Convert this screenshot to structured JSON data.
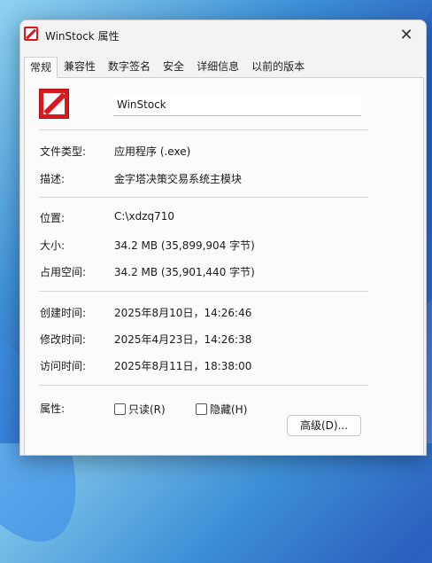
{
  "window": {
    "title": "WinStock 属性",
    "close_glyph": "✕"
  },
  "tabs": [
    {
      "label": "常规",
      "active": true
    },
    {
      "label": "兼容性"
    },
    {
      "label": "数字签名"
    },
    {
      "label": "安全"
    },
    {
      "label": "详细信息"
    },
    {
      "label": "以前的版本"
    }
  ],
  "general": {
    "file_name": "WinStock",
    "rows": {
      "type": {
        "label": "文件类型:",
        "value": "应用程序 (.exe)"
      },
      "description": {
        "label": "描述:",
        "value": "金字塔决策交易系统主模块"
      },
      "location": {
        "label": "位置:",
        "value": "C:\\xdzq710"
      },
      "size": {
        "label": "大小:",
        "value": "34.2 MB (35,899,904 字节)"
      },
      "size_on_disk": {
        "label": "占用空间:",
        "value": "34.2 MB (35,901,440 字节)"
      },
      "created": {
        "label": "创建时间:",
        "value": "2025年8月10日，14:26:46"
      },
      "modified": {
        "label": "修改时间:",
        "value": "2025年4月23日，14:26:38"
      },
      "accessed": {
        "label": "访问时间:",
        "value": "2025年8月11日，18:38:00"
      }
    },
    "attributes": {
      "label": "属性:",
      "readonly_label": "只读(R)",
      "hidden_label": "隐藏(H)",
      "advanced_button": "高级(D)..."
    }
  },
  "colors": {
    "icon_red": "#d71920",
    "dialog_bg": "#f3f3f3",
    "panel_bg": "#fbfbfb"
  },
  "icons": {
    "app": "winstock-app-icon",
    "close": "close-icon"
  }
}
